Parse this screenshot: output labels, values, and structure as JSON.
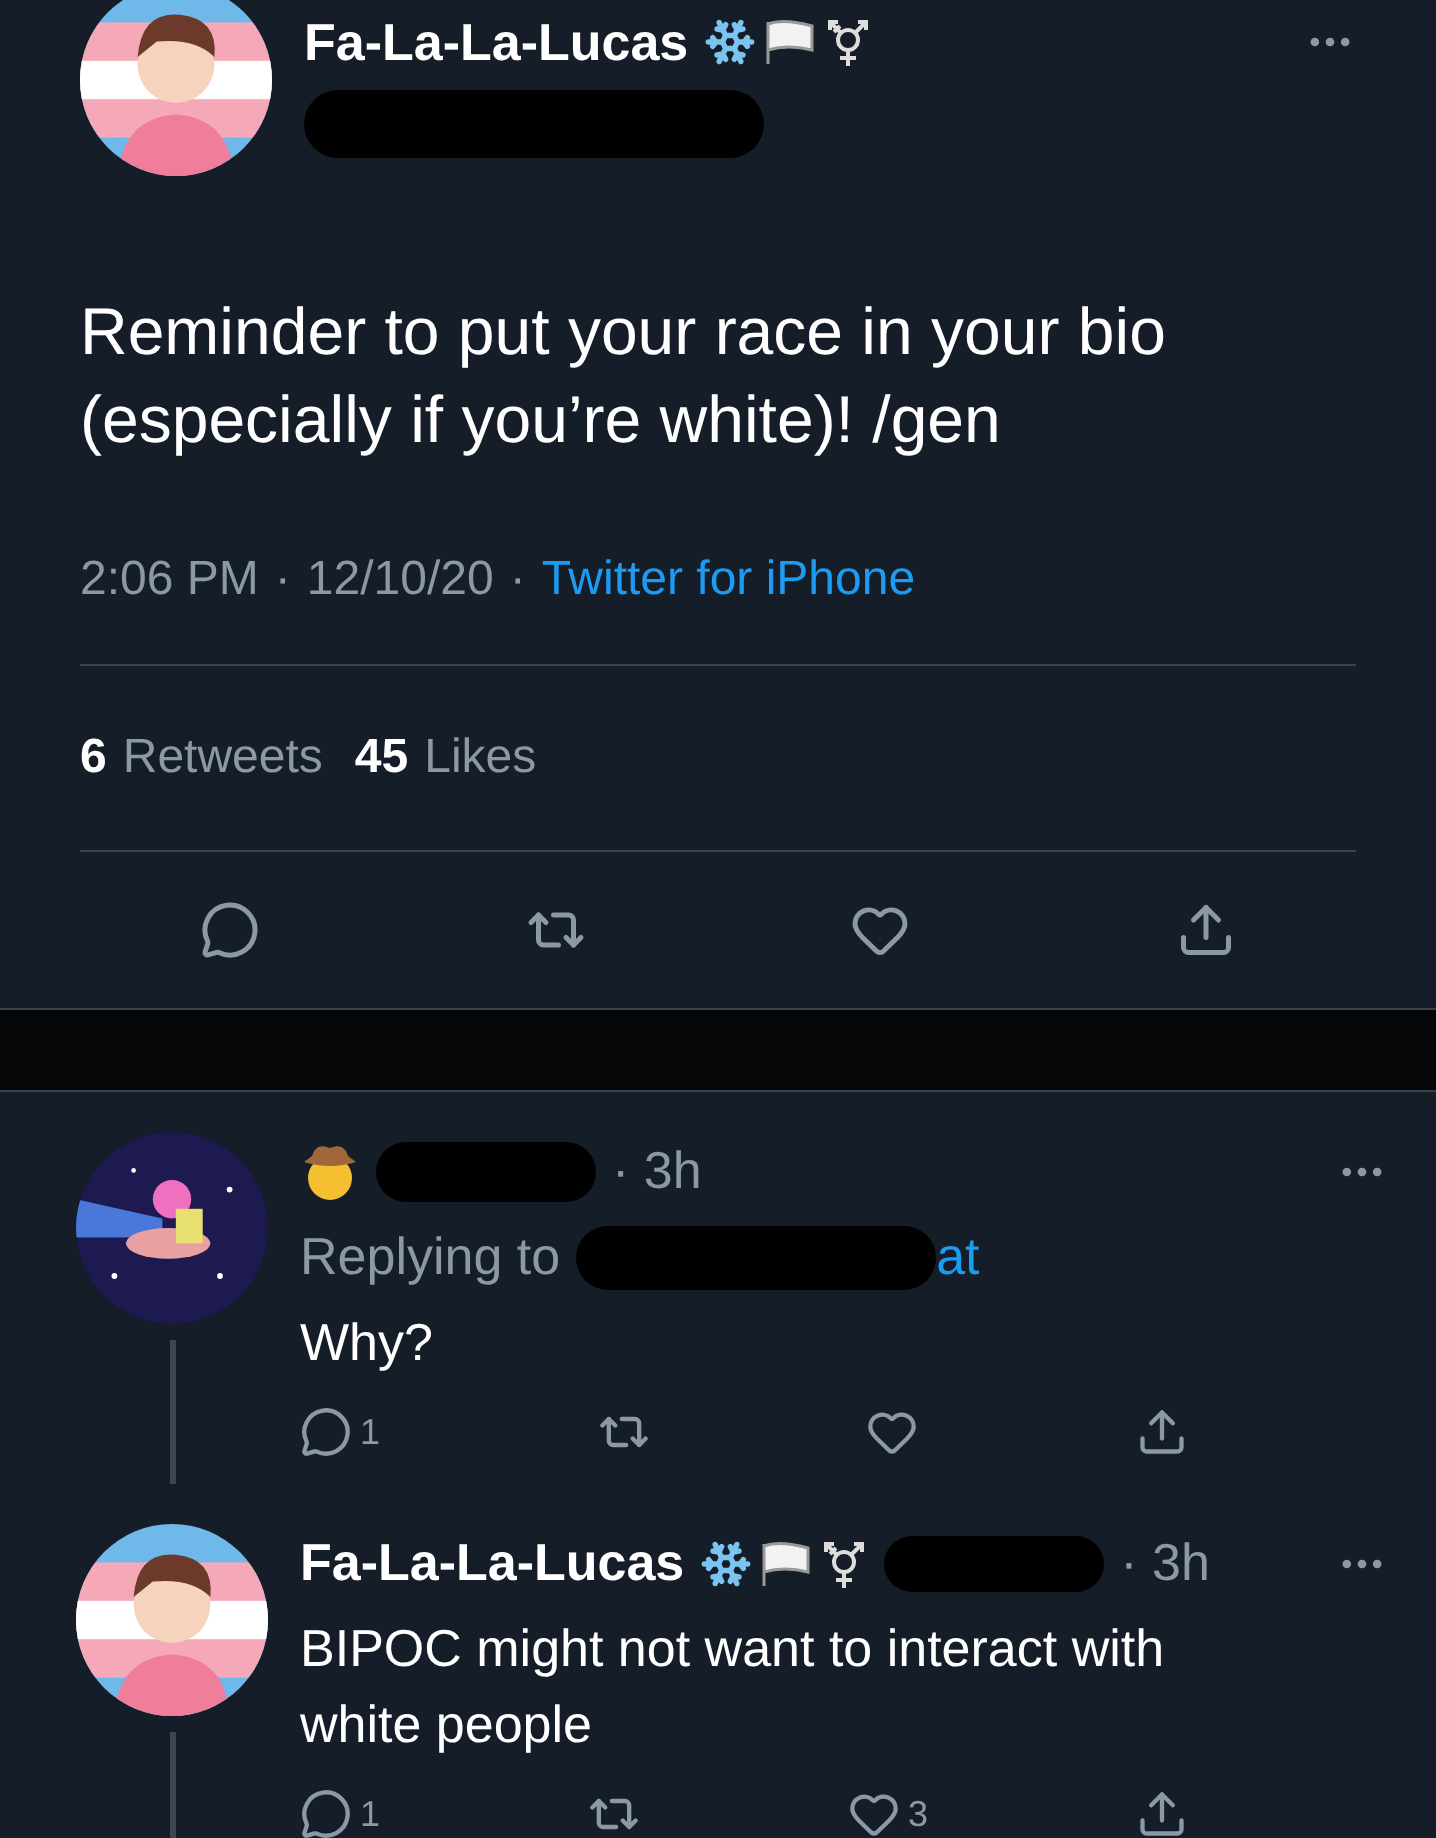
{
  "tweet": {
    "author": "Fa-La-La-Lucas",
    "text": "Reminder to put your race in your bio\n(especially if you’re white)! /gen",
    "meta": [
      {
        "kind": "text",
        "label": "2:06 PM"
      },
      {
        "kind": "text",
        "label": "·"
      },
      {
        "kind": "text",
        "label": "12/10/20"
      },
      {
        "kind": "text",
        "label": "·"
      },
      {
        "kind": "link",
        "label": "Twitter for iPhone"
      }
    ],
    "stats": [
      {
        "count": "6",
        "label": "Retweets"
      },
      {
        "count": "45",
        "label": "Likes"
      }
    ]
  },
  "replies": [
    {
      "kind": "reply_to",
      "time": "· 3h",
      "replying_label": "Replying to",
      "handle_end": "at",
      "text": "Why?",
      "reply_count": "1"
    },
    {
      "kind": "named",
      "author": "Fa-La-La-Lucas",
      "time": "· 3h",
      "text": "BIPOC might not want to interact with\nwhite people",
      "reply_count": "1",
      "like_count": "3"
    }
  ]
}
